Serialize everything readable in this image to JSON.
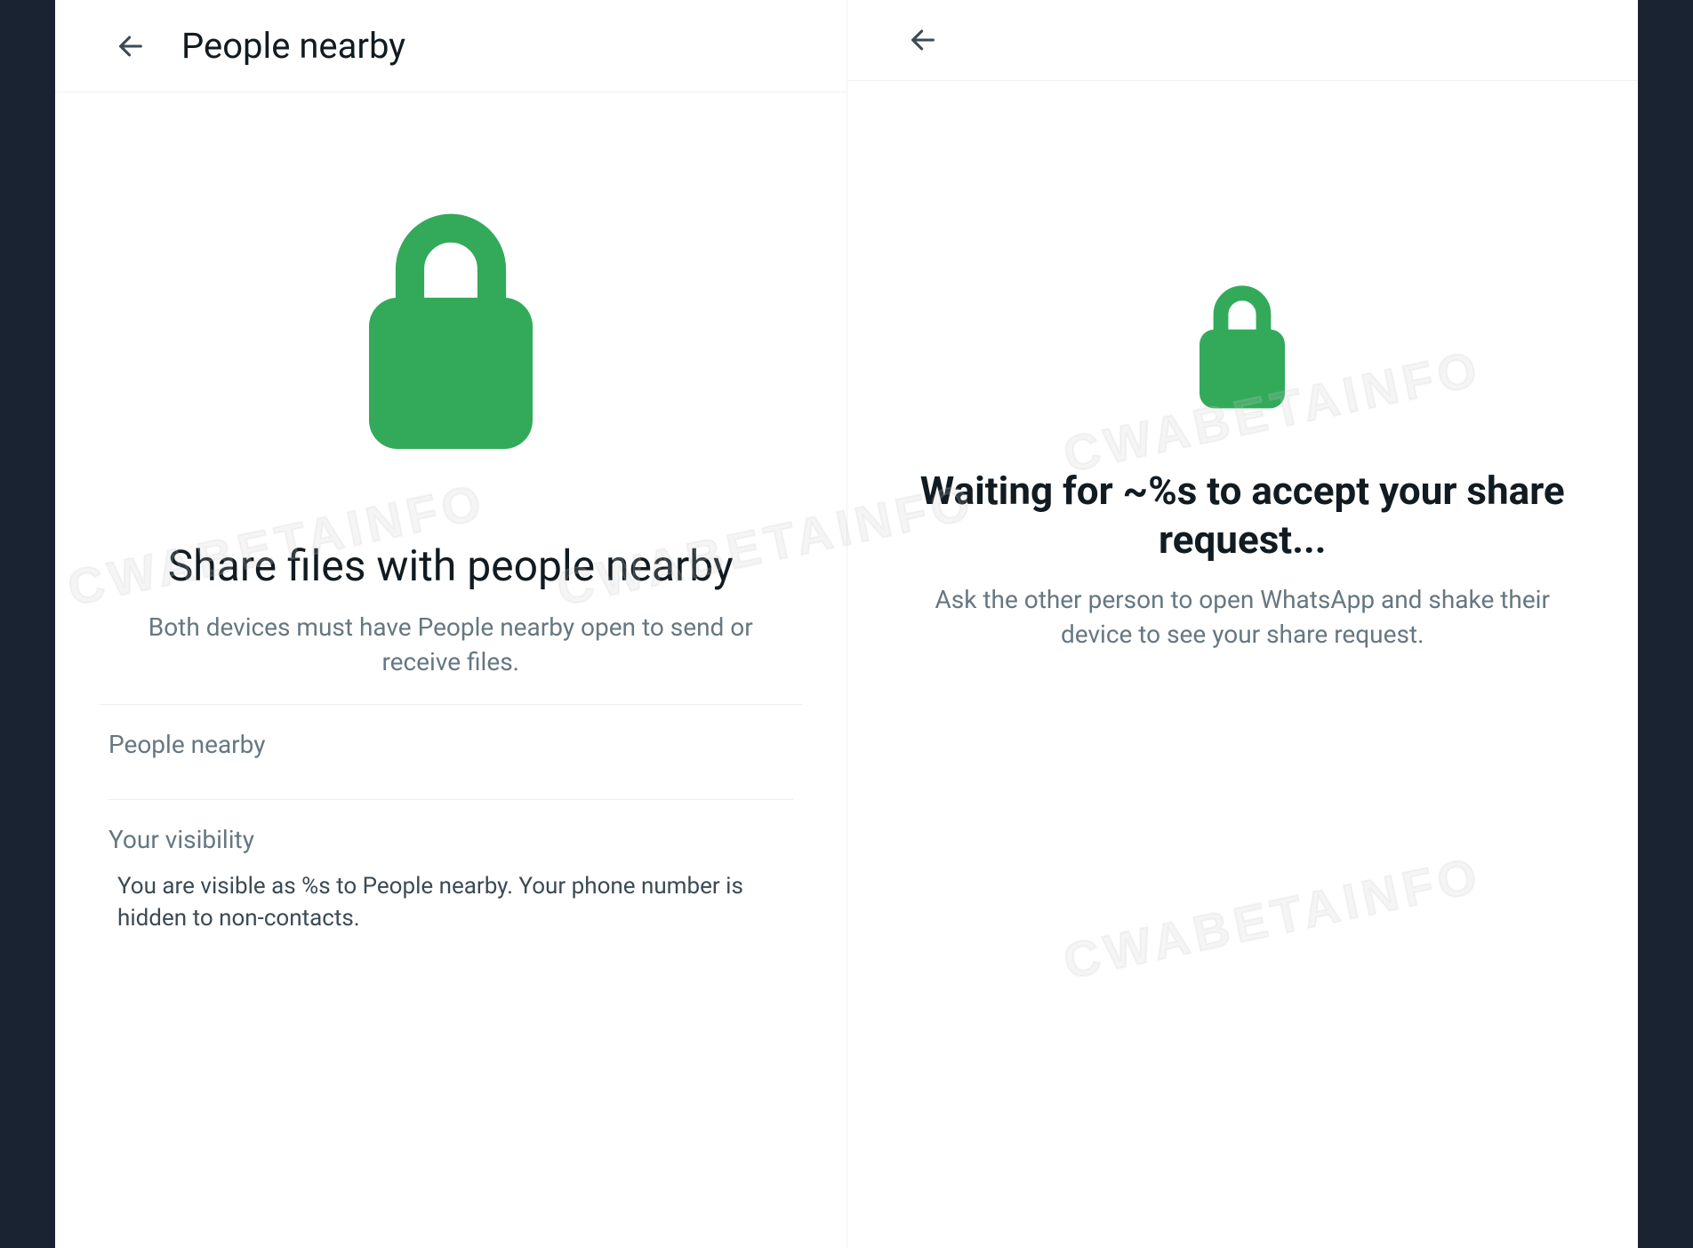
{
  "colors": {
    "accent_green": "#25d366",
    "lock_green": "#33aa5a"
  },
  "left": {
    "header_title": "People nearby",
    "heading": "Share files with people nearby",
    "subtext": "Both devices must have People nearby open to send or receive files.",
    "section_people": "People nearby",
    "section_visibility": "Your visibility",
    "visibility_detail": "You are visible as %s to People nearby. Your phone number is hidden to non-contacts."
  },
  "right": {
    "heading": "Waiting for ~%s to accept your share request...",
    "subtext": "Ask the other person to open WhatsApp and shake their device to see your share request."
  },
  "watermark": "CWABETAINFO"
}
